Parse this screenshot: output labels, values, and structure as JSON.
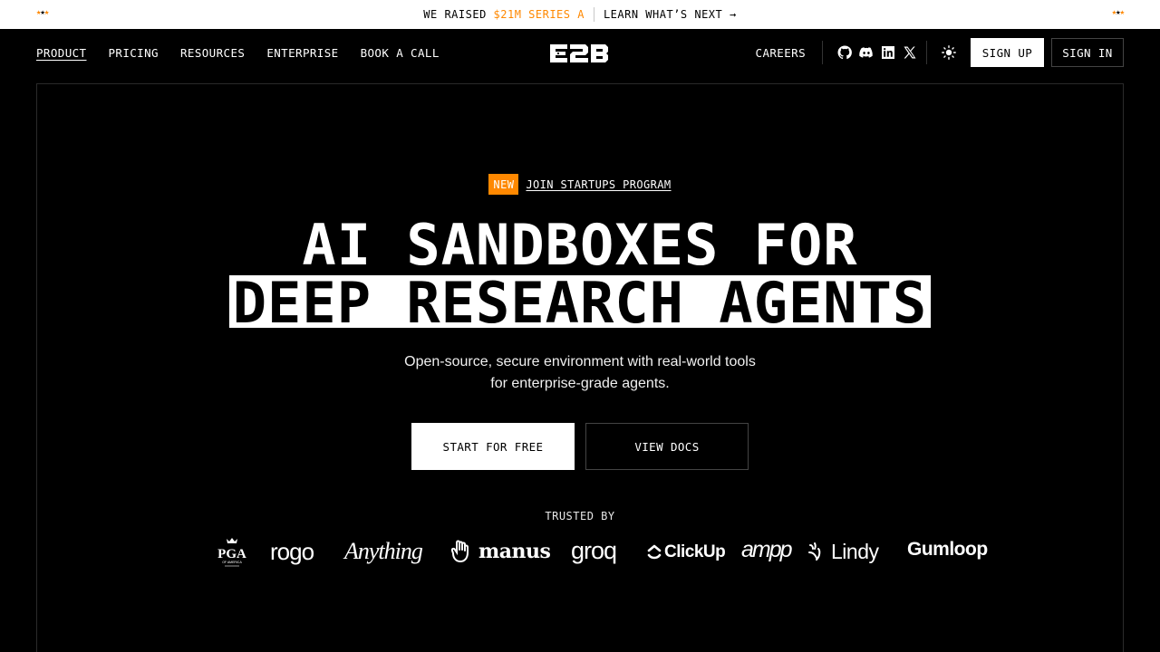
{
  "announcement": {
    "stars_left": "★★★",
    "stars_right": "★★★",
    "prefix": "WE RAISED ",
    "highlight": "$21M SERIES A",
    "link_label": "LEARN WHAT’S NEXT →"
  },
  "nav": {
    "items": [
      {
        "label": "PRODUCT"
      },
      {
        "label": "PRICING"
      },
      {
        "label": "RESOURCES"
      },
      {
        "label": "ENTERPRISE"
      },
      {
        "label": "BOOK A CALL"
      }
    ],
    "logo_text": "E2B",
    "careers": "CAREERS",
    "social_icons": [
      "github-icon",
      "discord-icon",
      "linkedin-icon",
      "x-icon"
    ],
    "theme_icon": "sun-icon",
    "sign_up": "SIGN UP",
    "sign_in": "SIGN IN"
  },
  "hero": {
    "badge": "NEW",
    "badge_link": "JOIN STARTUPS PROGRAM",
    "title_line1": "AI SANDBOXES FOR",
    "title_line2": "DEEP RESEARCH AGENTS",
    "subtitle_line1": "Open-source, secure environment with real-world tools",
    "subtitle_line2": "for enterprise-grade agents.",
    "cta_primary": "START FOR FREE",
    "cta_secondary": "VIEW DOCS"
  },
  "trusted": {
    "label": "TRUSTED BY",
    "logos": [
      "PGA",
      "rogo",
      "Anything",
      "manus",
      "groq",
      "ClickUp",
      "ampp",
      "Lindy",
      "Gumloop"
    ]
  },
  "colors": {
    "accent": "#ff8800",
    "background": "#000000",
    "text": "#ffffff"
  }
}
